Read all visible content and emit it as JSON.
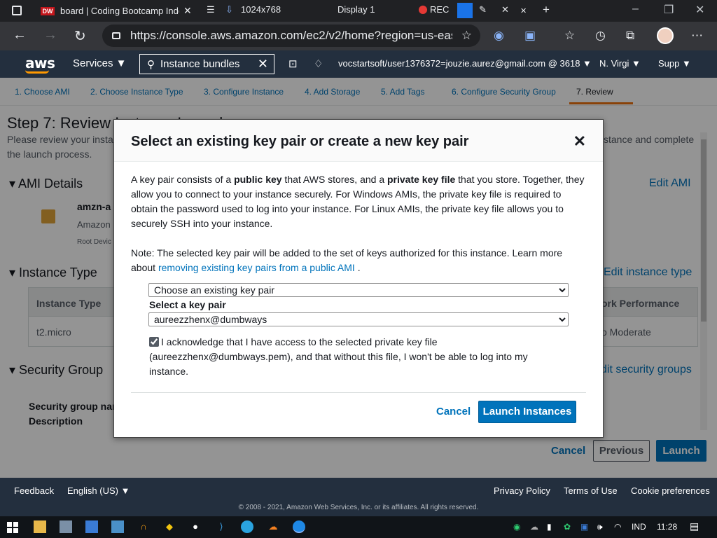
{
  "browser": {
    "tab_title": "board | Coding Bootcamp Indon",
    "tab_favicon": "DW",
    "toolbar_resolution": "1024x768",
    "toolbar_display": "Display 1",
    "toolbar_rec": "REC",
    "url": "https://console.aws.amazon.com/ec2/v2/home?region=us-eas..."
  },
  "aws_nav": {
    "logo": "aws",
    "services_label": "Services ▼",
    "search_value": "Instance bundles",
    "account": "vocstartsoft/user1376372=jouzie.aurez@gmail.com @ 3618 ▼",
    "region": "N. Virgi ▼",
    "support": "Supp ▼"
  },
  "steps": [
    "1. Choose AMI",
    "2. Choose Instance Type",
    "3. Configure Instance",
    "4. Add Storage",
    "5. Add Tags",
    "6. Configure Security Group",
    "7. Review"
  ],
  "page": {
    "title": "Step 7: Review Instance Launch",
    "subtitle_left": "Please review your insta",
    "subtitle_right": "stance and complete",
    "subtitle_line2": "the launch process.",
    "ami_section": "AMI Details",
    "edit_ami": "Edit AMI",
    "ami_name": "amzn-a",
    "ami_desc": "Amazon",
    "ami_root": "Root Devic",
    "instance_section": "Instance Type",
    "edit_instance": "Edit instance type",
    "col_instance_type": "Instance Type",
    "col_network": "ork Performance",
    "row_instance": "t2.micro",
    "row_network": "o Moderate",
    "security_section": "Security Group",
    "edit_security": "dit security groups",
    "sg_name": "Security group nar",
    "sg_desc": "Description",
    "cancel": "Cancel",
    "previous": "Previous",
    "launch": "Launch"
  },
  "modal": {
    "title": "Select an existing key pair or create a new key pair",
    "body_1": "A key pair consists of a ",
    "body_bold_1": "public key",
    "body_2": " that AWS stores, and a ",
    "body_bold_2": "private key file",
    "body_3": " that you store. Together, they allow you to connect to your instance securely. For Windows AMIs, the private key file is required to obtain the password used to log into your instance. For Linux AMIs, the private key file allows you to securely SSH into your instance.",
    "note_text": "Note: The selected key pair will be added to the set of keys authorized for this instance. Learn more about ",
    "note_link": "removing existing key pairs from a public AMI",
    "note_end": " .",
    "option_select": "Choose an existing key pair",
    "key_pair_label": "Select a key pair",
    "key_pair_value": "aureezzhenx@dumbways",
    "acknowledge": "I acknowledge that I have access to the selected private key file (aureezzhenx@dumbways.pem), and that without this file, I won't be able to log into my instance.",
    "acknowledge_checked": true,
    "cancel": "Cancel",
    "launch": "Launch Instances"
  },
  "footer": {
    "feedback": "Feedback",
    "language": "English (US) ▼",
    "privacy": "Privacy Policy",
    "terms": "Terms of Use",
    "cookies": "Cookie preferences",
    "copyright": "© 2008 - 2021, Amazon Web Services, Inc. or its affiliates. All rights reserved."
  },
  "taskbar": {
    "lang": "IND",
    "time": "11:28"
  },
  "colors": {
    "aws_nav": "#232f3e",
    "accent": "#0073bb",
    "aws_orange": "#ff9900"
  }
}
